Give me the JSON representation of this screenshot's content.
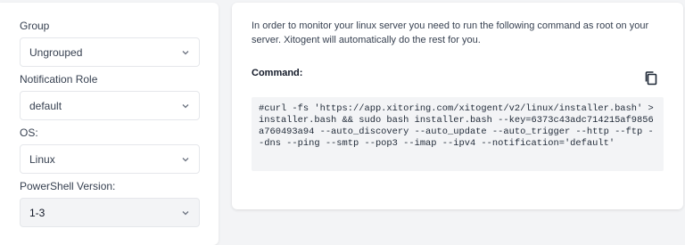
{
  "form": {
    "group_label": "Group",
    "group_value": "Ungrouped",
    "notification_role_label": "Notification Role",
    "notification_role_value": "default",
    "os_label": "OS:",
    "os_value": "Linux",
    "powershell_label": "PowerShell Version:",
    "powershell_value": "1-3"
  },
  "instructions": {
    "text": "In order to monitor your linux server you need to run the following command as root on your server. Xitogent will automatically do the rest for you.",
    "command_label": "Command:",
    "command": "#curl -fs 'https://app.xitoring.com/xitogent/v2/linux/installer.bash' > installer.bash && sudo bash installer.bash --key=6373c43adc714215af9856a760493a94 --auto_discovery --auto_update --auto_trigger --http --ftp --dns --ping --smtp --pop3 --imap --ipv4 --notification='default'"
  },
  "icons": {
    "select_arrow": "chevron-down-icon",
    "copy": "copy-icon"
  }
}
